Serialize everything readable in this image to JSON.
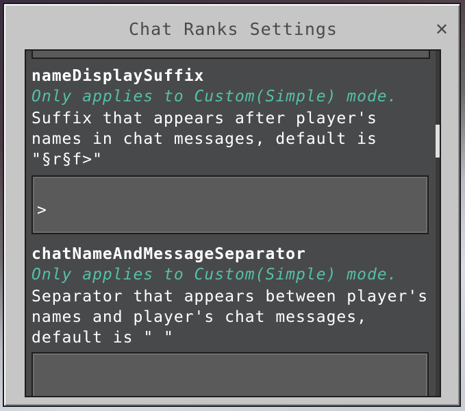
{
  "window": {
    "title": "Chat Ranks Settings",
    "close_icon": "close-icon"
  },
  "settings": [
    {
      "name": "nameDisplaySuffix",
      "note": "Only applies to Custom(Simple) mode.",
      "description": "Suffix that appears after player's names in chat messages, default is \"§r§f>\"",
      "value": ">"
    },
    {
      "name": "chatNameAndMessageSeparator",
      "note": "Only applies to Custom(Simple) mode.",
      "description": "Separator that appears between player's names and player's chat messages, default is \" \"",
      "value": ""
    }
  ],
  "colors": {
    "note": "#54c0a8",
    "panel": "#c6c6c6",
    "content": "#48494a"
  }
}
